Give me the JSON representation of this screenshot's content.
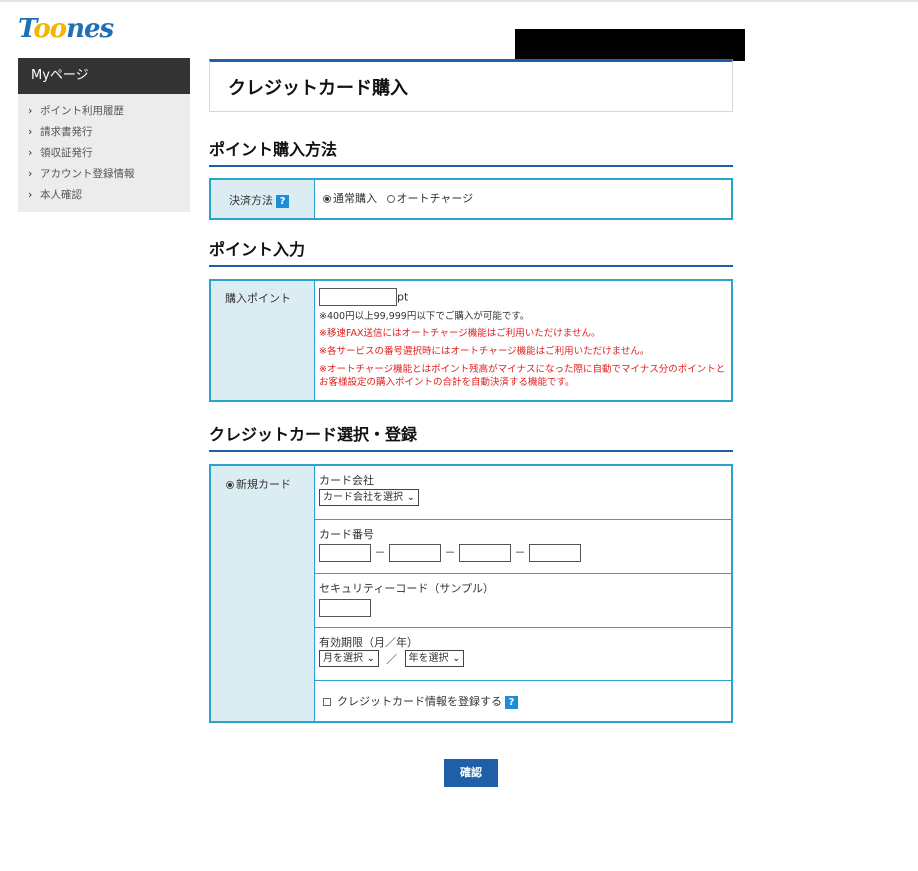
{
  "logo": {
    "text_pre": "T",
    "text_oo": "oo",
    "text_post": "nes"
  },
  "sidebar": {
    "title": "Myページ",
    "items": [
      {
        "label": "ポイント利用履歴"
      },
      {
        "label": "請求書発行"
      },
      {
        "label": "領収証発行"
      },
      {
        "label": "アカウント登録情報"
      },
      {
        "label": "本人確認"
      }
    ]
  },
  "page_title": "クレジットカード購入",
  "section_method": {
    "title": "ポイント購入方法",
    "label": "決済方法",
    "help_icon": "?",
    "option_normal": "通常購入",
    "option_auto": "オートチャージ",
    "selected": "通常購入"
  },
  "section_points": {
    "title": "ポイント入力",
    "label": "購入ポイント",
    "input_value": "",
    "unit": "pt",
    "note1": "※400円以上99,999円以下でご購入が可能です。",
    "note2": "※移速FAX送信にはオートチャージ機能はご利用いただけません。",
    "note3": "※各サービスの番号選択時にはオートチャージ機能はご利用いただけません。",
    "note4": "※オートチャージ機能とはポイント残高がマイナスになった際に自動でマイナス分のポイントとお客様設定の購入ポイントの合計を自動決済する機能です。"
  },
  "section_card": {
    "title": "クレジットカード選択・登録",
    "new_card_label": "新規カード",
    "company_label": "カード会社",
    "company_select": "カード会社を選択",
    "number_label": "カード番号",
    "number_sep": "－",
    "security_label": "セキュリティーコード（サンプル）",
    "expiry_label": "有効期限（月／年）",
    "month_select": "月を選択",
    "expiry_sep": "／",
    "year_select": "年を選択",
    "register_label": "クレジットカード情報を登録する"
  },
  "confirm_button": "確認",
  "colors": {
    "accent": "#1e5fa8",
    "table_border": "#2ba3cf",
    "label_bg": "#dcecf3",
    "note_red": "#e02020"
  }
}
